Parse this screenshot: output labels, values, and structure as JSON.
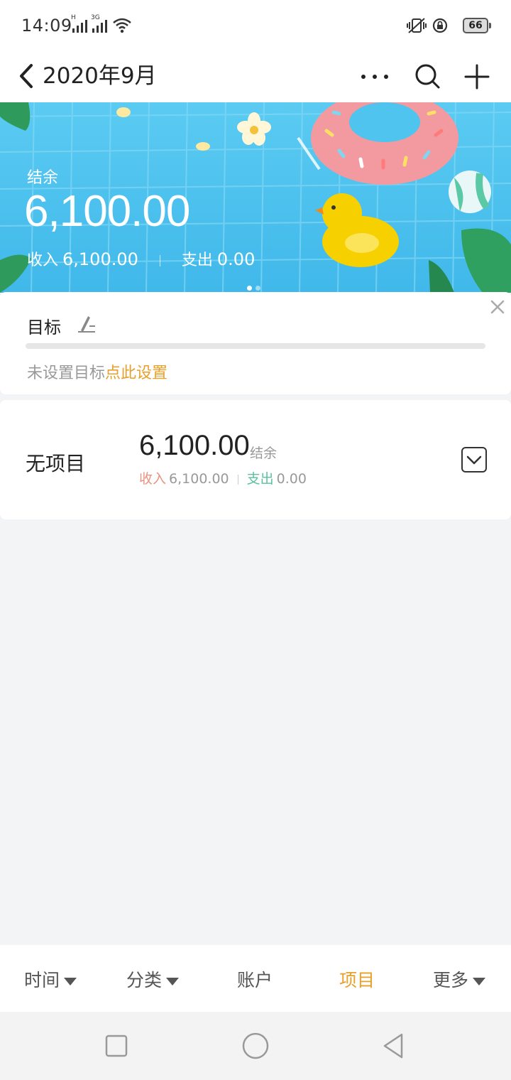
{
  "status_bar": {
    "time": "14:09",
    "signal1_tag": "H",
    "signal2_tag": "3G",
    "battery": "66",
    "icons": [
      "signal-icon",
      "signal-icon",
      "wifi-icon",
      "vibrate-icon",
      "rotation-lock-icon",
      "battery-icon"
    ]
  },
  "nav": {
    "title": "2020年9月",
    "icons": [
      "back-icon",
      "more-icon",
      "search-icon",
      "add-icon"
    ]
  },
  "banner": {
    "balance_label": "结余",
    "balance": "6,100.00",
    "income_label": "收入",
    "income": "6,100.00",
    "expense_label": "支出",
    "expense": "0.00",
    "pages": 2,
    "active_page": 1
  },
  "goal": {
    "title": "目标",
    "hint": "未设置目标",
    "link": "点此设置",
    "progress": 0
  },
  "project": {
    "name": "无项目",
    "balance": "6,100.00",
    "balance_label": "结余",
    "income_label": "收入",
    "income": "6,100.00",
    "expense_label": "支出",
    "expense": "0.00"
  },
  "tabs": [
    {
      "label": "时间",
      "dropdown": true
    },
    {
      "label": "分类",
      "dropdown": true
    },
    {
      "label": "账户",
      "dropdown": false
    },
    {
      "label": "项目",
      "dropdown": false,
      "active": true
    },
    {
      "label": "更多",
      "dropdown": true
    }
  ],
  "colors": {
    "accent": "#e8a02b",
    "income": "#e89480",
    "expense": "#5ac29c",
    "banner": "#4ec4ee"
  }
}
